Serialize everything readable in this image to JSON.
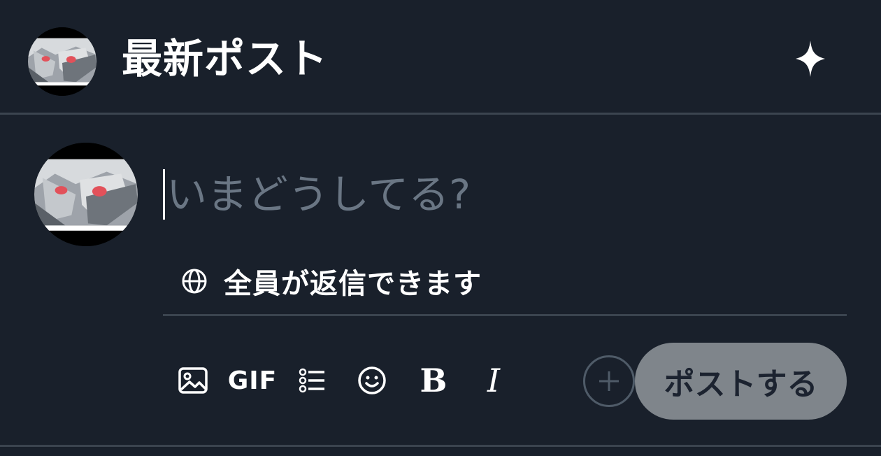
{
  "header": {
    "title": "最新ポスト",
    "avatar_icon": "user-avatar",
    "action_icon": "sparkle-icon"
  },
  "composer": {
    "placeholder": "いまどうしてる?",
    "reply_setting": "全員が返信できます",
    "reply_icon": "globe-icon"
  },
  "toolbar": {
    "media_icon": "image-icon",
    "gif_label": "GIF",
    "list_icon": "list-icon",
    "emoji_icon": "emoji-icon",
    "bold_label": "B",
    "italic_label": "I",
    "add_icon": "plus-icon",
    "post_label": "ポストする"
  },
  "colors": {
    "background": "#19202b",
    "border": "#3b444f",
    "placeholder": "#6a7684",
    "post_button_bg": "#7f858b",
    "post_button_text": "#1c2330"
  }
}
